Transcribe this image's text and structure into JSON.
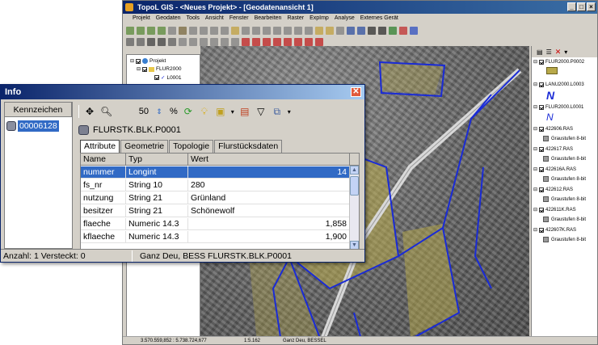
{
  "app": {
    "title": "TopoL GIS - <Neues Projekt> - [Geodatenansicht 1]",
    "menu": [
      "Projekt",
      "Geodaten",
      "Tools",
      "Ansicht",
      "Fenster",
      "Bearbeiten",
      "Raster",
      "ExpImp",
      "Analyse",
      "Externes Gerät"
    ]
  },
  "tree": {
    "items": [
      {
        "label": "Projekt",
        "checked": true
      },
      {
        "label": "FLUR2000",
        "checked": true
      },
      {
        "label": "L0001",
        "checked": true
      }
    ]
  },
  "legend": {
    "layers": [
      {
        "label": "FLUR2000.P0002",
        "checked": true,
        "sub": ""
      },
      {
        "label": "LANU2000.L0003",
        "checked": true,
        "sub": ""
      },
      {
        "label": "FLUR2000.L0001",
        "checked": true,
        "sub": ""
      },
      {
        "label": "422606.RAS",
        "checked": true,
        "sub": "Graustufen 8-bit"
      },
      {
        "label": "422617.RAS",
        "checked": true,
        "sub": "Graustufen 8-bit"
      },
      {
        "label": "422616A.RAS",
        "checked": true,
        "sub": "Graustufen 8-bit"
      },
      {
        "label": "422612.RAS",
        "checked": true,
        "sub": "Graustufen 8-bit"
      },
      {
        "label": "422611K.RAS",
        "checked": true,
        "sub": "Graustufen 8-bit"
      },
      {
        "label": "422607K.RAS",
        "checked": true,
        "sub": "Graustufen 8-bit"
      }
    ]
  },
  "statusbar": {
    "coords": "3.570.559,852 : 5.738.724,677",
    "scale": "1:5.162",
    "crs": "Ganz Deu, BESSEL"
  },
  "info": {
    "title": "Info",
    "left_header": "Kennzeichen",
    "selected_id": "00006128",
    "zoom_value": "50",
    "zoom_unit": "%",
    "object_label": "FLURSTK.BLK.P0001",
    "tabs": [
      "Attribute",
      "Geometrie",
      "Topologie",
      "Flurstücksdaten"
    ],
    "active_tab": 0,
    "columns": [
      "Name",
      "Typ",
      "Wert"
    ],
    "rows": [
      {
        "name": "nummer",
        "type": "Longint",
        "value": "14",
        "numeric": true,
        "selected": true
      },
      {
        "name": "fs_nr",
        "type": "String 10",
        "value": "280",
        "numeric": false,
        "selected": false
      },
      {
        "name": "nutzung",
        "type": "String 21",
        "value": "Grünland",
        "numeric": false,
        "selected": false
      },
      {
        "name": "besitzer",
        "type": "String 21",
        "value": "Schönewolf",
        "numeric": false,
        "selected": false
      },
      {
        "name": "flaeche",
        "type": "Numeric 14.3",
        "value": "1,858",
        "numeric": true,
        "selected": false
      },
      {
        "name": "kflaeche",
        "type": "Numeric 14.3",
        "value": "1,900",
        "numeric": true,
        "selected": false
      }
    ],
    "status_left": "Anzahl: 1  Versteckt: 0",
    "status_right": "Ganz Deu, BESS FLURSTK.BLK.P0001"
  },
  "colors": {
    "selection": "#316ac5",
    "parcel_outline": "#1a2bd6",
    "field_tint": "#b8a94a"
  }
}
